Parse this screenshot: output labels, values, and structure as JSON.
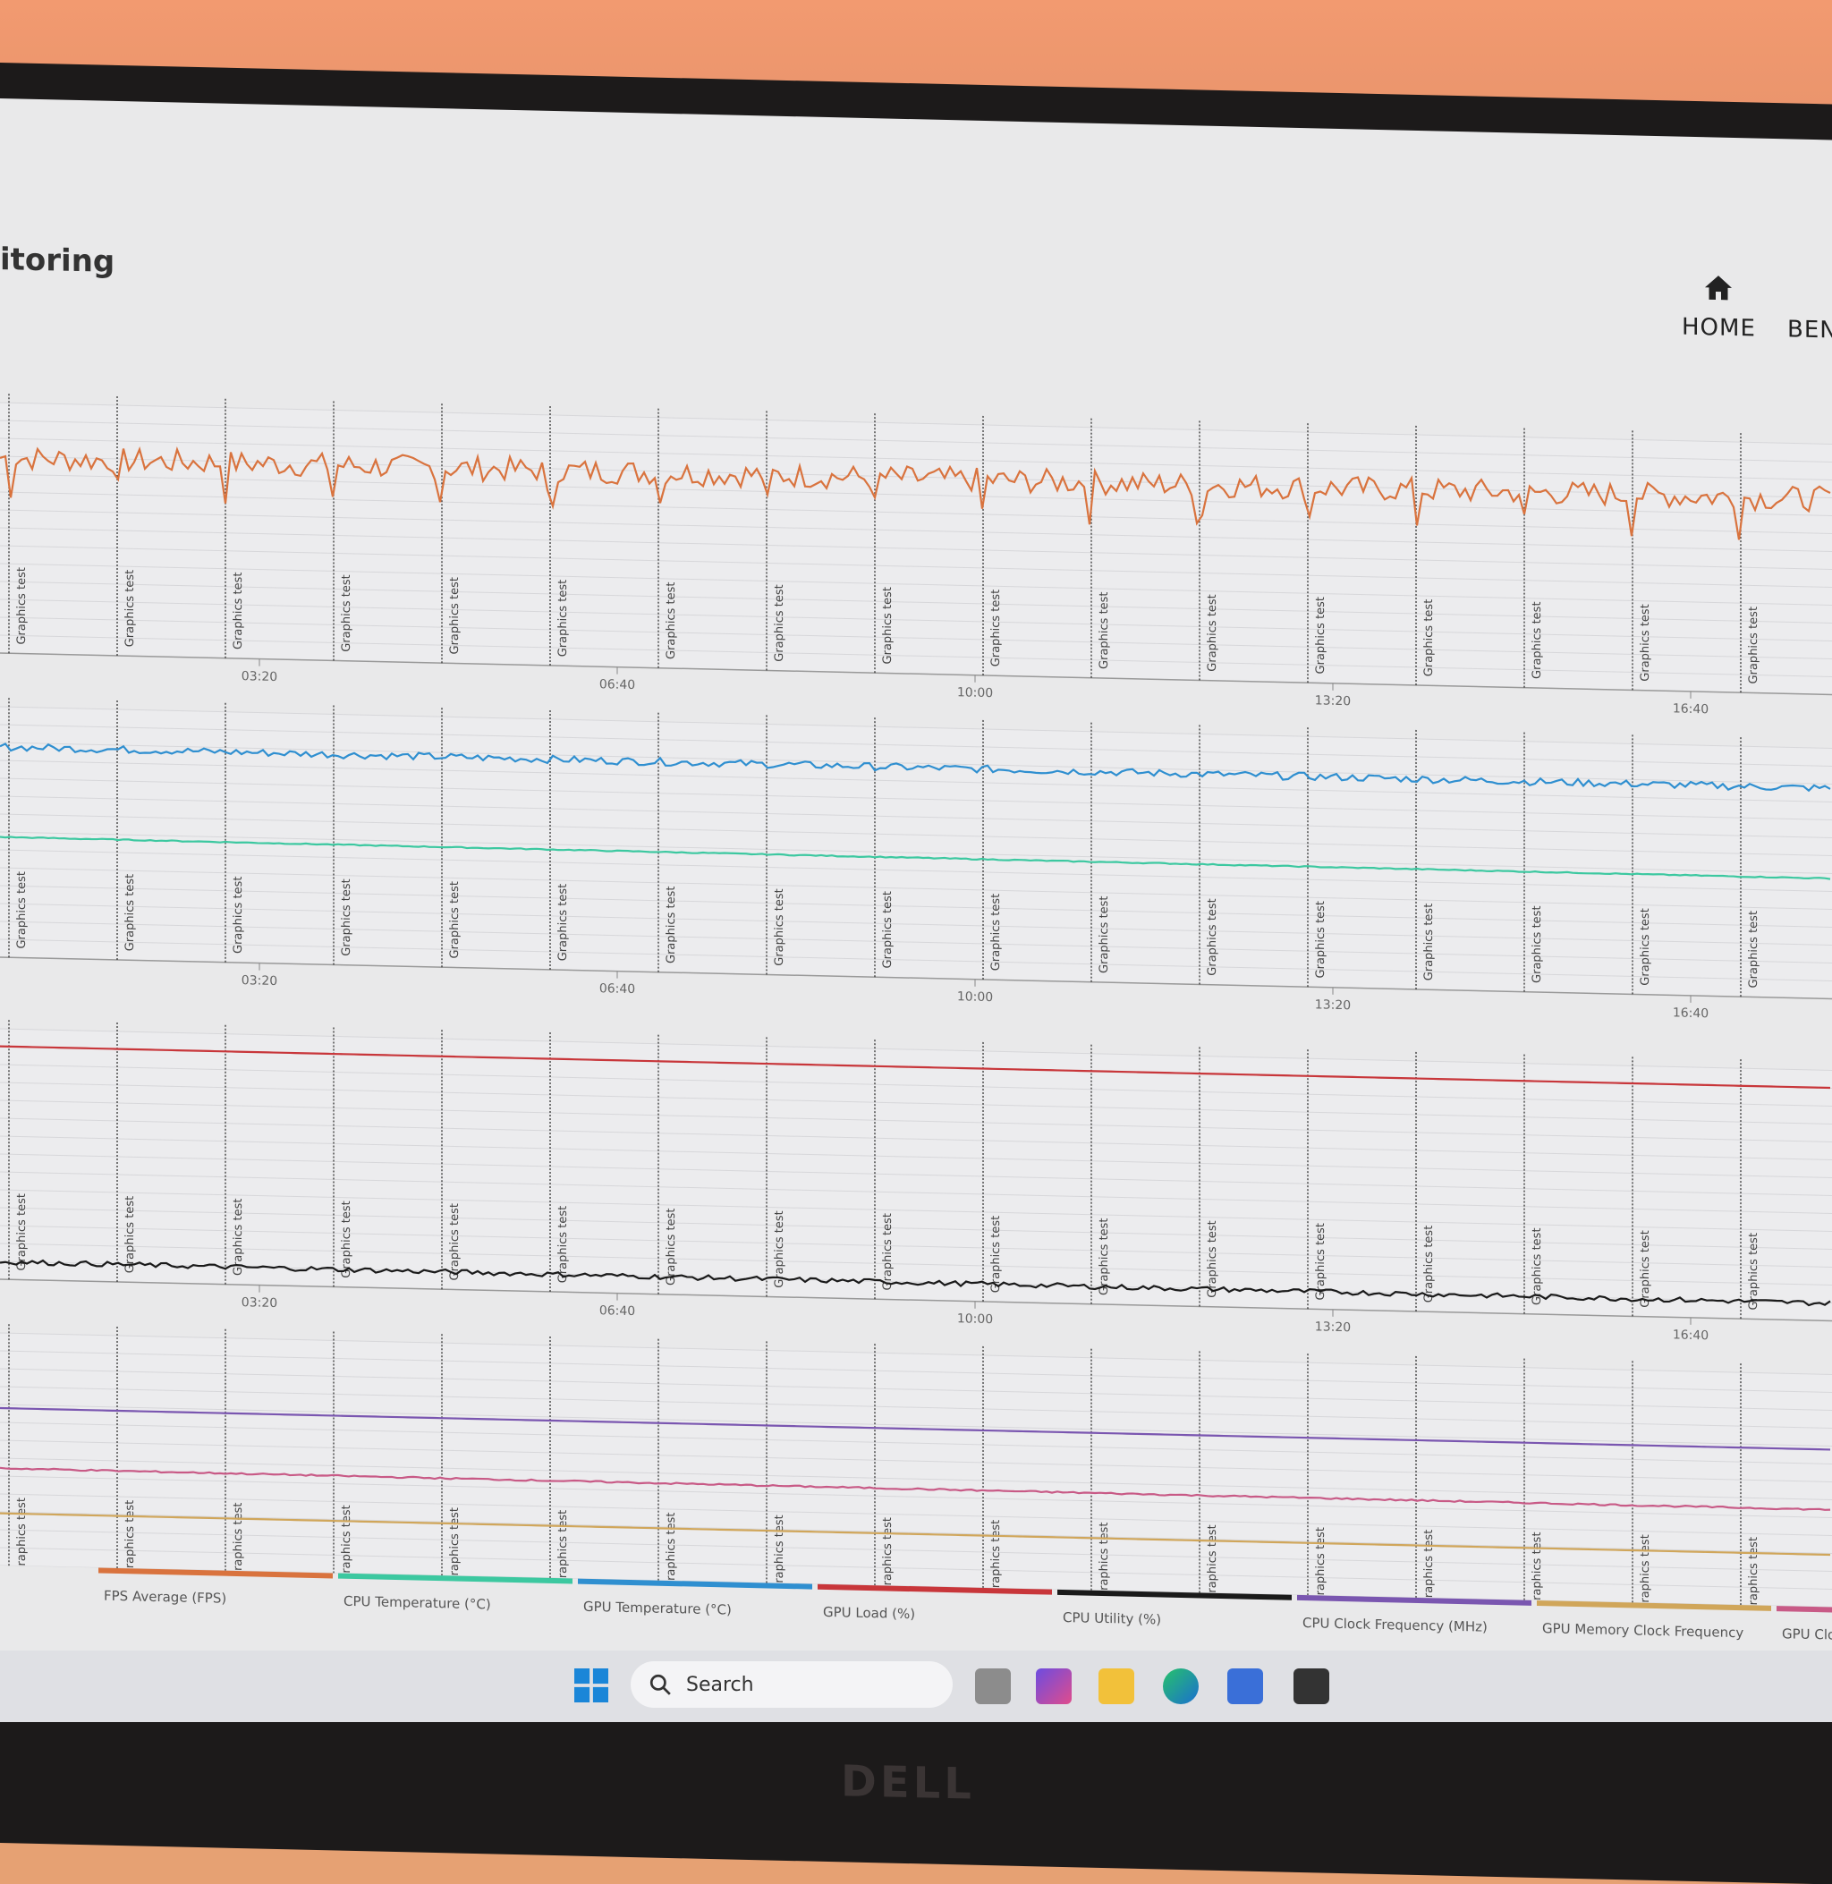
{
  "app": {
    "title_partial": "itoring"
  },
  "nav": {
    "home_label": "HOME",
    "bench_label": "BEN"
  },
  "event_marker_label": "Graphics test",
  "time_ticks": [
    "03:20",
    "06:40",
    "10:00",
    "13:20",
    "16:40"
  ],
  "legend": [
    {
      "label": "FPS Average (FPS)",
      "color": "#d9733e"
    },
    {
      "label": "CPU Temperature (°C)",
      "color": "#3cc8a0"
    },
    {
      "label": "GPU Temperature (°C)",
      "color": "#2f8fd0"
    },
    {
      "label": "GPU Load (%)",
      "color": "#c8363a"
    },
    {
      "label": "CPU Utility (%)",
      "color": "#1a1a1a"
    },
    {
      "label": "CPU Clock Frequency (MHz)",
      "color": "#7a56b0"
    },
    {
      "label": "GPU Memory Clock Frequency (MHz)",
      "color": "#d0a65a"
    },
    {
      "label": "GPU Cloc",
      "color": "#c85a86"
    }
  ],
  "taskbar": {
    "search_placeholder": "Search",
    "m365_label": "M365"
  },
  "monitor_brand": "DELL",
  "chart_data": [
    {
      "type": "line",
      "panel": "fps",
      "series": [
        {
          "name": "FPS Average (FPS)",
          "color": "#d9733e",
          "level": 0.78,
          "noise": 0.05,
          "dips": true
        }
      ]
    },
    {
      "type": "line",
      "panel": "temperature",
      "series": [
        {
          "name": "GPU Temperature (°C)",
          "color": "#2f8fd0",
          "level": 0.84,
          "noise": 0.015
        },
        {
          "name": "CPU Temperature (°C)",
          "color": "#3cc8a0",
          "level": 0.48,
          "noise": 0.002
        }
      ]
    },
    {
      "type": "line",
      "panel": "load",
      "series": [
        {
          "name": "GPU Load (%)",
          "color": "#c8363a",
          "level": 0.93,
          "noise": 0.0
        },
        {
          "name": "CPU Utility (%)",
          "color": "#1a1a1a",
          "level": 0.07,
          "noise": 0.01
        }
      ]
    },
    {
      "type": "line",
      "panel": "clocks",
      "series": [
        {
          "name": "CPU Clock Frequency (MHz)",
          "color": "#7a56b0",
          "level": 0.7,
          "noise": 0.0
        },
        {
          "name": "GPU Cloc",
          "color": "#c85a86",
          "level": 0.46,
          "noise": 0.003
        },
        {
          "name": "GPU Memory Clock Frequency (MHz)",
          "color": "#d0a65a",
          "level": 0.28,
          "noise": 0.0
        }
      ]
    }
  ]
}
